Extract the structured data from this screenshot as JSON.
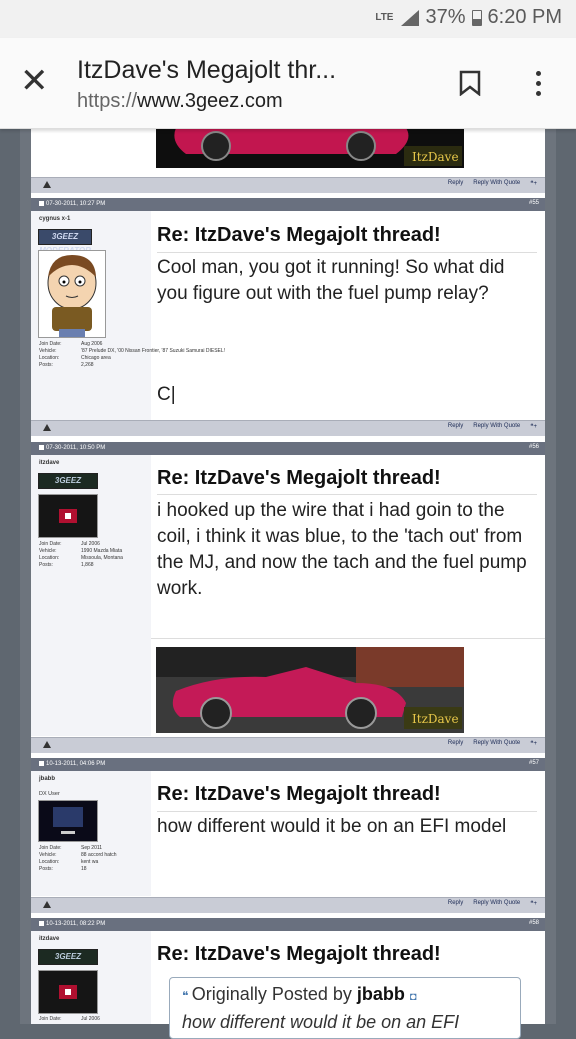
{
  "status": {
    "network": "LTE",
    "battery": "37%",
    "time": "6:20 PM"
  },
  "browser": {
    "title": "ItzDave's Megajolt thr...",
    "url_scheme": "https://",
    "url_host": "www.3geez.com"
  },
  "controls": {
    "reply": "Reply",
    "reply_quote": "Reply With Quote"
  },
  "image_caption": "ItzDave",
  "posts": [
    {
      "date": "07-30-2011, 10:27 PM",
      "num": "#55",
      "user": "cygnus x-1",
      "badge": "3GEEZ MODERATOR",
      "info": [
        [
          "Join Date:",
          "Aug 2006"
        ],
        [
          "Vehicle:",
          "'87 Prelude DX, '00 Nissan Frontier, '87 Suzuki Samurai DIESEL!"
        ],
        [
          "Location:",
          "Chicago area"
        ],
        [
          "Posts:",
          "2,268"
        ]
      ],
      "title": "Re: ItzDave's Megajolt thread!",
      "text": "Cool man, you got it running! So what did you figure out with the fuel pump relay?",
      "sig": "C|"
    },
    {
      "date": "07-30-2011, 10:50 PM",
      "num": "#56",
      "user": "itzdave",
      "badge": "3GEEZ",
      "info": [
        [
          "Join Date:",
          "Jul 2006"
        ],
        [
          "Vehicle:",
          "1990 Mazda Miata"
        ],
        [
          "Location:",
          "Missoula, Montana"
        ],
        [
          "Posts:",
          "1,868"
        ]
      ],
      "title": "Re: ItzDave's Megajolt thread!",
      "text": "i hooked up the wire that i had goin to the coil, i think it was blue, to the 'tach out' from the MJ, and now the tach and the fuel pump work."
    },
    {
      "date": "10-13-2011, 04:06 PM",
      "num": "#57",
      "user": "jbabb",
      "utitle": "DX User",
      "info": [
        [
          "Join Date:",
          "Sep 2011"
        ],
        [
          "Vehicle:",
          "88 accord hatch"
        ],
        [
          "Location:",
          "kent wa"
        ],
        [
          "Posts:",
          "18"
        ]
      ],
      "title": "Re: ItzDave's Megajolt thread!",
      "text": "how different would it be on an EFI model"
    },
    {
      "date": "10-13-2011, 08:22 PM",
      "num": "#58",
      "user": "itzdave",
      "badge": "3GEEZ",
      "info": [
        [
          "Join Date:",
          "Jul 2006"
        ]
      ],
      "title": "Re: ItzDave's Megajolt thread!",
      "quote_prefix": "Originally Posted by ",
      "quote_user": "jbabb",
      "quote_text": "how different would it be on an EFI"
    }
  ]
}
